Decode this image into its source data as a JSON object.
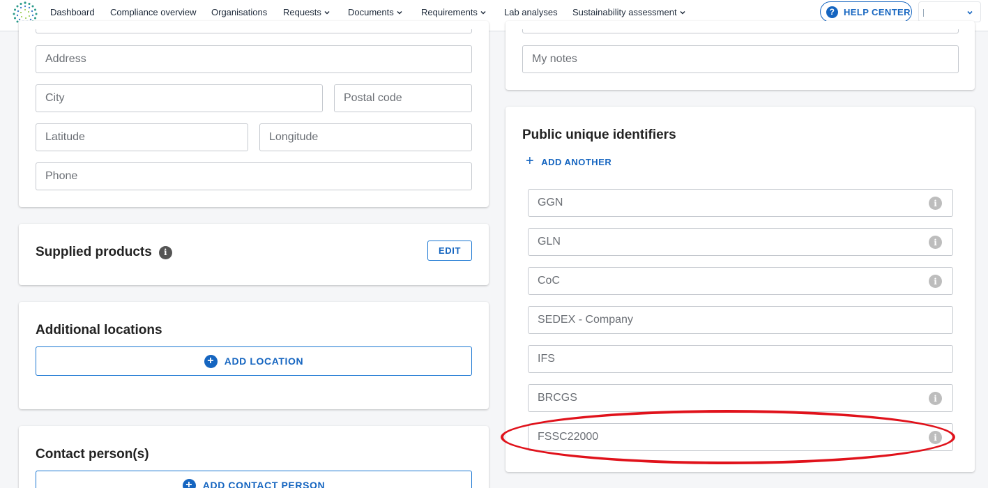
{
  "nav": {
    "items": [
      {
        "label": "Dashboard",
        "dropdown": false
      },
      {
        "label": "Compliance overview",
        "dropdown": false
      },
      {
        "label": "Organisations",
        "dropdown": false
      },
      {
        "label": "Requests",
        "dropdown": true
      },
      {
        "label": "Documents",
        "dropdown": true
      },
      {
        "label": "Requirements",
        "dropdown": true
      },
      {
        "label": "Lab analyses",
        "dropdown": false
      },
      {
        "label": "Sustainability assessment",
        "dropdown": true
      }
    ],
    "help_center": "HELP CENTER",
    "help_icon": "?",
    "language_value": ""
  },
  "address_card": {
    "address_placeholder": "Address",
    "city_placeholder": "City",
    "postal_code_placeholder": "Postal code",
    "latitude_placeholder": "Latitude",
    "longitude_placeholder": "Longitude",
    "phone_placeholder": "Phone"
  },
  "supplied_products": {
    "title": "Supplied products",
    "info_icon": "i",
    "edit_label": "EDIT"
  },
  "additional_locations": {
    "title": "Additional locations",
    "add_label": "ADD LOCATION",
    "add_icon": "+"
  },
  "contact_persons": {
    "title": "Contact person(s)",
    "add_label": "ADD CONTACT PERSON",
    "add_icon": "+"
  },
  "notes_card": {
    "notes_placeholder": "My notes"
  },
  "identifiers": {
    "title": "Public unique identifiers",
    "add_another_label": "ADD ANOTHER",
    "add_another_icon": "+",
    "info_icon": "i",
    "fields": [
      {
        "label": "GGN",
        "has_info": true
      },
      {
        "label": "GLN",
        "has_info": true
      },
      {
        "label": "CoC",
        "has_info": true
      },
      {
        "label": "SEDEX - Company",
        "has_info": false
      },
      {
        "label": "IFS",
        "has_info": false
      },
      {
        "label": "BRCGS",
        "has_info": true
      },
      {
        "label": "FSSC22000",
        "has_info": true
      }
    ]
  },
  "colors": {
    "primary": "#1565c0",
    "highlight": "#e0121b",
    "background": "#f5f6f8"
  }
}
